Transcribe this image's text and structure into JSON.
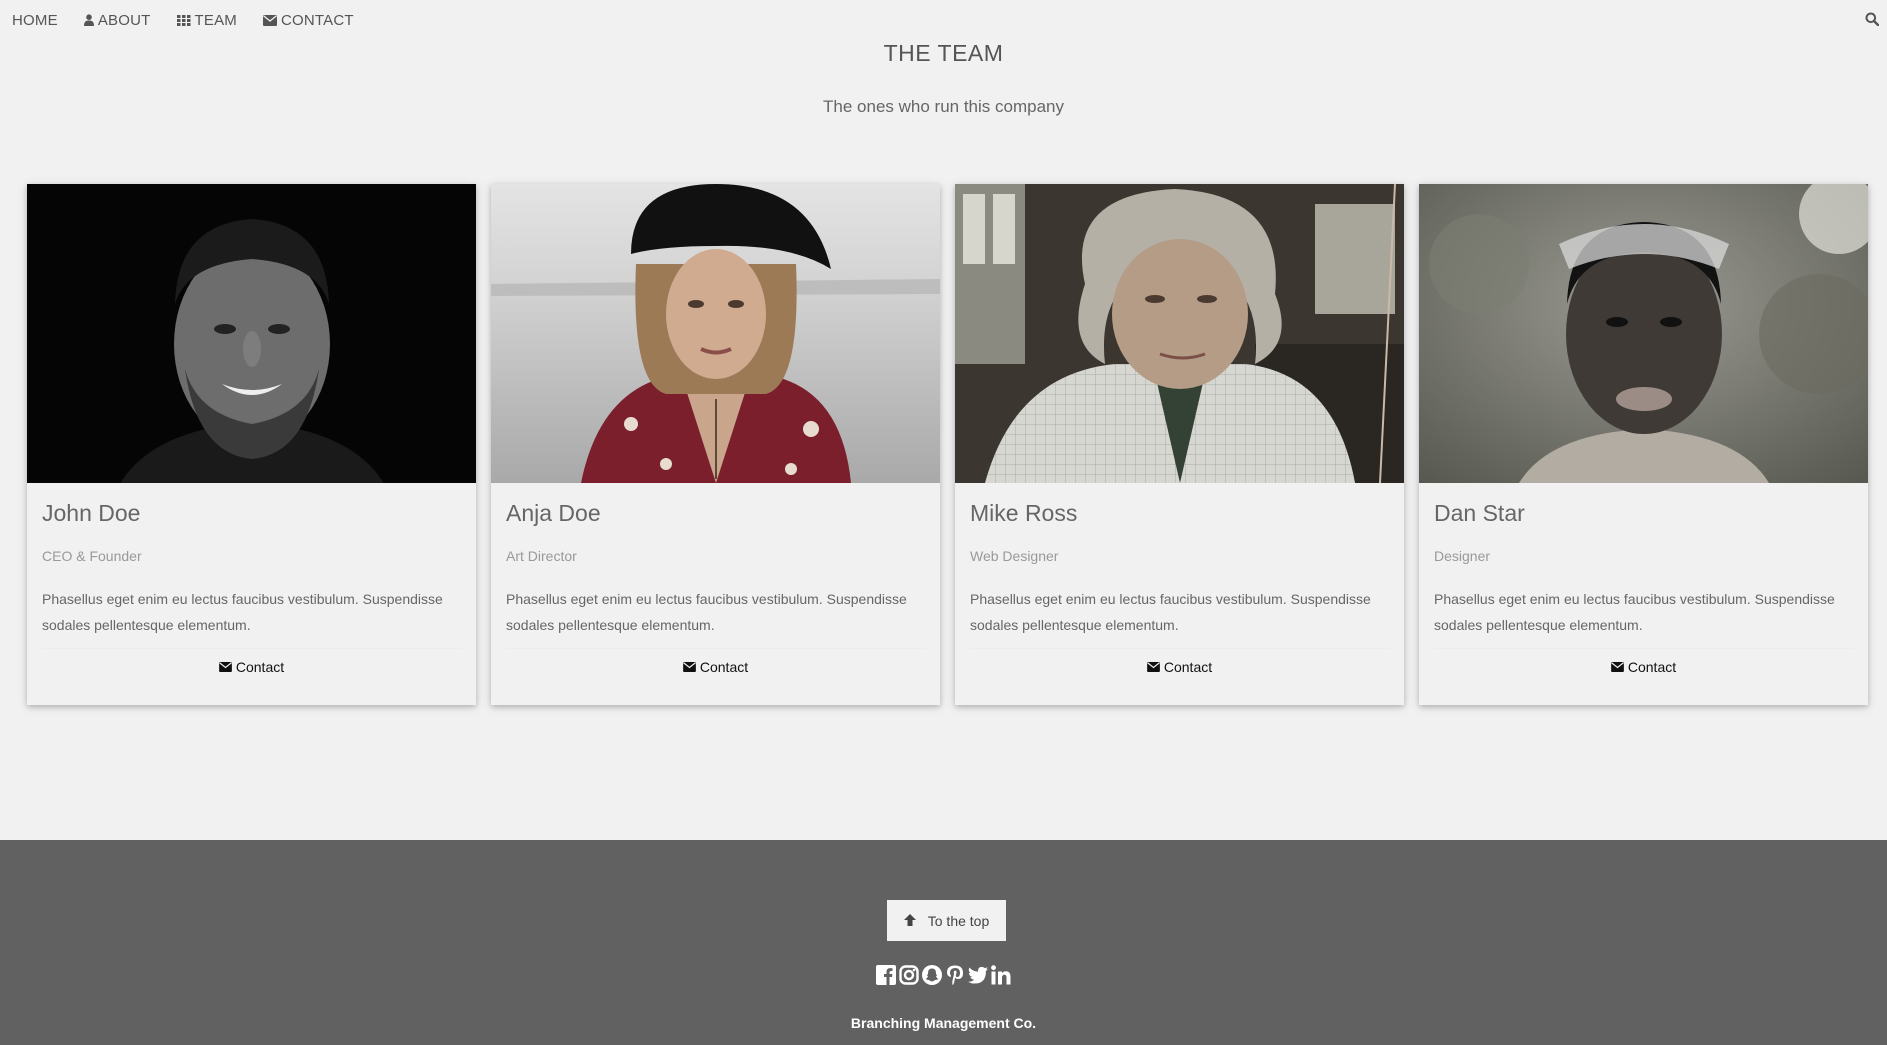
{
  "nav": {
    "items": [
      {
        "label": "HOME",
        "icon": ""
      },
      {
        "label": "ABOUT",
        "icon": "user-icon"
      },
      {
        "label": "TEAM",
        "icon": "grid-icon"
      },
      {
        "label": "CONTACT",
        "icon": "envelope-icon"
      }
    ],
    "search_icon": "search-icon"
  },
  "header": {
    "title": "THE TEAM",
    "subtitle": "The ones who run this company"
  },
  "team": [
    {
      "name": "John Doe",
      "role": "CEO & Founder",
      "description": "Phasellus eget enim eu lectus faucibus vestibulum. Suspendisse sodales pellentesque elementum.",
      "contact_label": "Contact"
    },
    {
      "name": "Anja Doe",
      "role": "Art Director",
      "description": "Phasellus eget enim eu lectus faucibus vestibulum. Suspendisse sodales pellentesque elementum.",
      "contact_label": "Contact"
    },
    {
      "name": "Mike Ross",
      "role": "Web Designer",
      "description": "Phasellus eget enim eu lectus faucibus vestibulum. Suspendisse sodales pellentesque elementum.",
      "contact_label": "Contact"
    },
    {
      "name": "Dan Star",
      "role": "Designer",
      "description": "Phasellus eget enim eu lectus faucibus vestibulum. Suspendisse sodales pellentesque elementum.",
      "contact_label": "Contact"
    }
  ],
  "footer": {
    "to_top_label": "To the top",
    "socials": [
      "facebook-icon",
      "instagram-icon",
      "snapchat-icon",
      "pinterest-icon",
      "twitter-icon",
      "linkedin-icon"
    ],
    "company": "Branching Management Co."
  },
  "colors": {
    "page_bg": "#f1f1f1",
    "footer_bg": "#616161",
    "text": "#555555"
  }
}
